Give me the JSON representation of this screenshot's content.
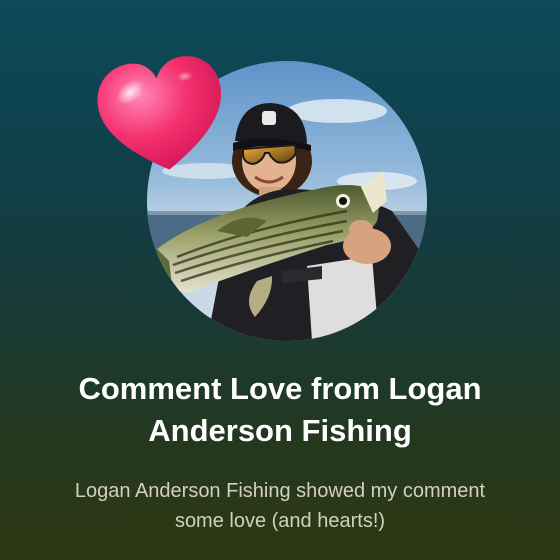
{
  "notification": {
    "title": "Comment Love from Logan Anderson Fishing",
    "body": "Logan Anderson Fishing showed my comment some love (and hearts!)"
  },
  "icons": {
    "reaction": "heart-icon",
    "profile_photo": "avatar"
  },
  "colors": {
    "background_top": "#0c4a59",
    "background_bottom": "#2f3712",
    "heart": "#f0286a",
    "title_text": "#ffffff",
    "body_text": "#d3cfc2"
  }
}
